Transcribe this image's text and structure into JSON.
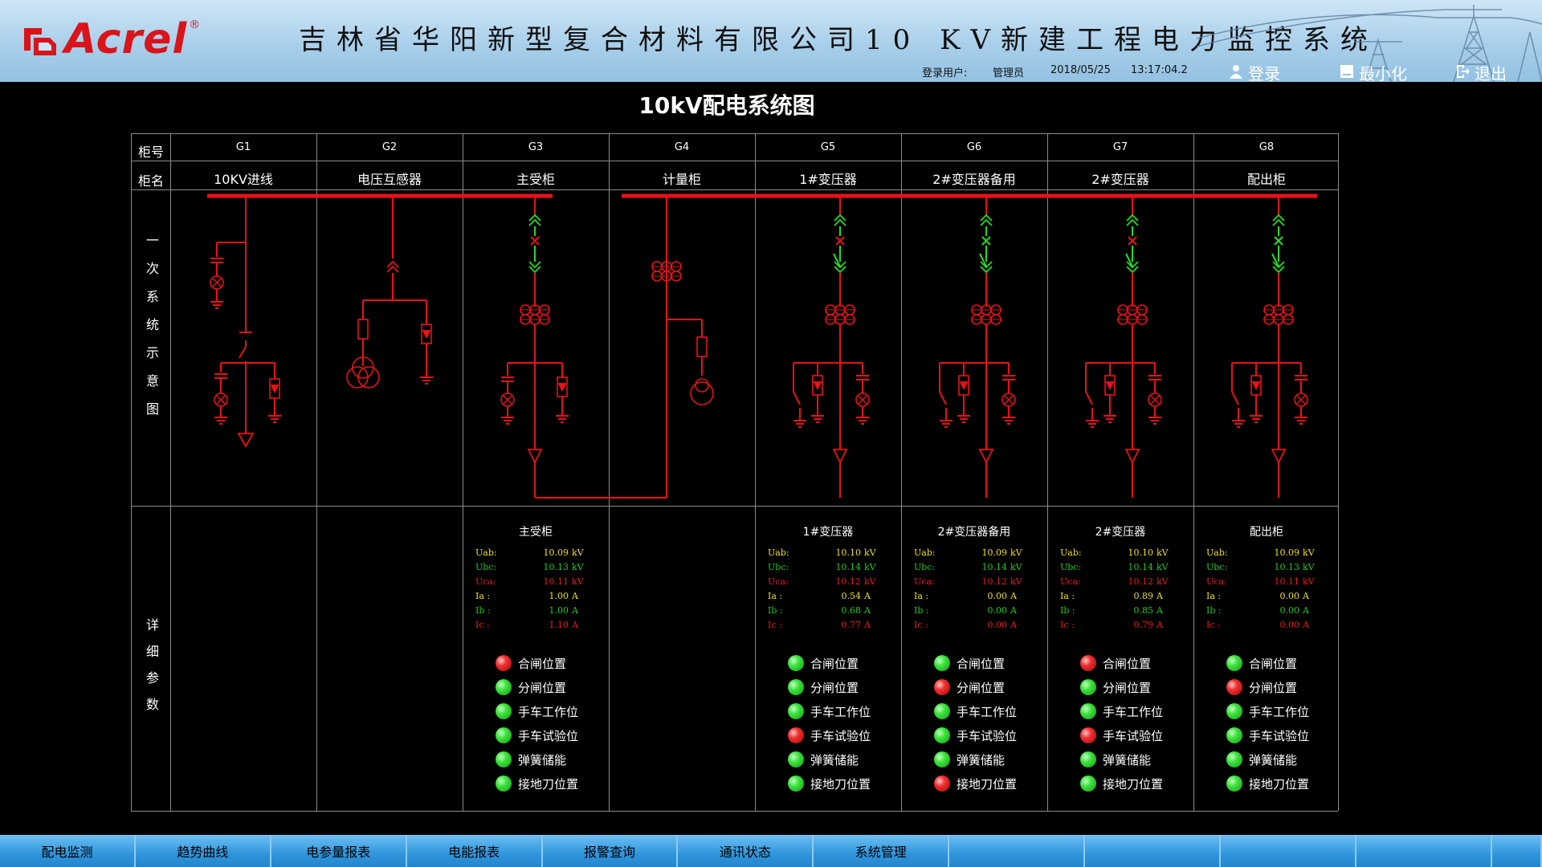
{
  "header": {
    "logo_text": "Acrel",
    "logo_reg": "®",
    "title": "吉林省华阳新型复合材料有限公司10 KV新建工程电力监控系统",
    "login_label": "登录用户:",
    "login_user": "管理员",
    "date": "2018/05/25",
    "time": "13:17:04.2",
    "login_btn": "登录",
    "minimize_btn": "最小化",
    "exit_btn": "退出"
  },
  "page_title": "10kV配电系统图",
  "row_labels": {
    "cabinet_no": "柜号",
    "cabinet_name": "柜名",
    "primary": [
      "一",
      "次",
      "系",
      "统",
      "示",
      "意",
      "图"
    ],
    "detail": [
      "详",
      "细",
      "参",
      "数"
    ]
  },
  "cabinets": [
    {
      "no": "G1",
      "name": "10KV进线"
    },
    {
      "no": "G2",
      "name": "电压互感器"
    },
    {
      "no": "G3",
      "name": "主受柜"
    },
    {
      "no": "G4",
      "name": "计量柜"
    },
    {
      "no": "G5",
      "name": "1#变压器"
    },
    {
      "no": "G6",
      "name": "2#变压器备用"
    },
    {
      "no": "G7",
      "name": "2#变压器"
    },
    {
      "no": "G8",
      "name": "配出柜"
    }
  ],
  "param_labels": {
    "uab": "Uab:",
    "ubc": "Ubc:",
    "uca": "Uca:",
    "ia": "Ia :",
    "ib": "Ib :",
    "ic": "Ic :",
    "kv": "kV",
    "a": "A"
  },
  "status_labels": [
    "合闸位置",
    "分闸位置",
    "手车工作位",
    "手车试验位",
    "弹簧储能",
    "接地刀位置"
  ],
  "details": [
    {
      "title": "主受柜",
      "uab": "10.09",
      "ubc": "10.13",
      "uca": "10.11",
      "ia": "1.00",
      "ib": "1.00",
      "ic": "1.10",
      "status": [
        "red",
        "green",
        "green",
        "green",
        "green",
        "green"
      ]
    },
    {
      "title": "1#变压器",
      "uab": "10.10",
      "ubc": "10.14",
      "uca": "10.12",
      "ia": "0.54",
      "ib": "0.68",
      "ic": "0.77",
      "status": [
        "green",
        "green",
        "green",
        "red",
        "green",
        "green"
      ]
    },
    {
      "title": "2#变压器备用",
      "uab": "10.09",
      "ubc": "10.14",
      "uca": "10.12",
      "ia": "0.00",
      "ib": "0.00",
      "ic": "0.00",
      "status": [
        "green",
        "red",
        "green",
        "green",
        "green",
        "red"
      ]
    },
    {
      "title": "2#变压器",
      "uab": "10.10",
      "ubc": "10.14",
      "uca": "10.12",
      "ia": "0.89",
      "ib": "0.85",
      "ic": "0.79",
      "status": [
        "red",
        "green",
        "green",
        "red",
        "green",
        "green"
      ]
    },
    {
      "title": "配出柜",
      "uab": "10.09",
      "ubc": "10.13",
      "uca": "10.11",
      "ia": "0.00",
      "ib": "0.00",
      "ic": "0.00",
      "status": [
        "green",
        "red",
        "green",
        "green",
        "green",
        "green"
      ]
    }
  ],
  "nav": [
    "配电监测",
    "趋势曲线",
    "电参量报表",
    "电能报表",
    "报警查询",
    "通讯状态",
    "系统管理",
    "",
    "",
    "",
    "",
    ""
  ],
  "colors": {
    "bus": "#e8111a",
    "line": "#e8111a",
    "switch": "#22dd22",
    "grid": "#8a8a8a",
    "nav": "#3b9fe0"
  }
}
